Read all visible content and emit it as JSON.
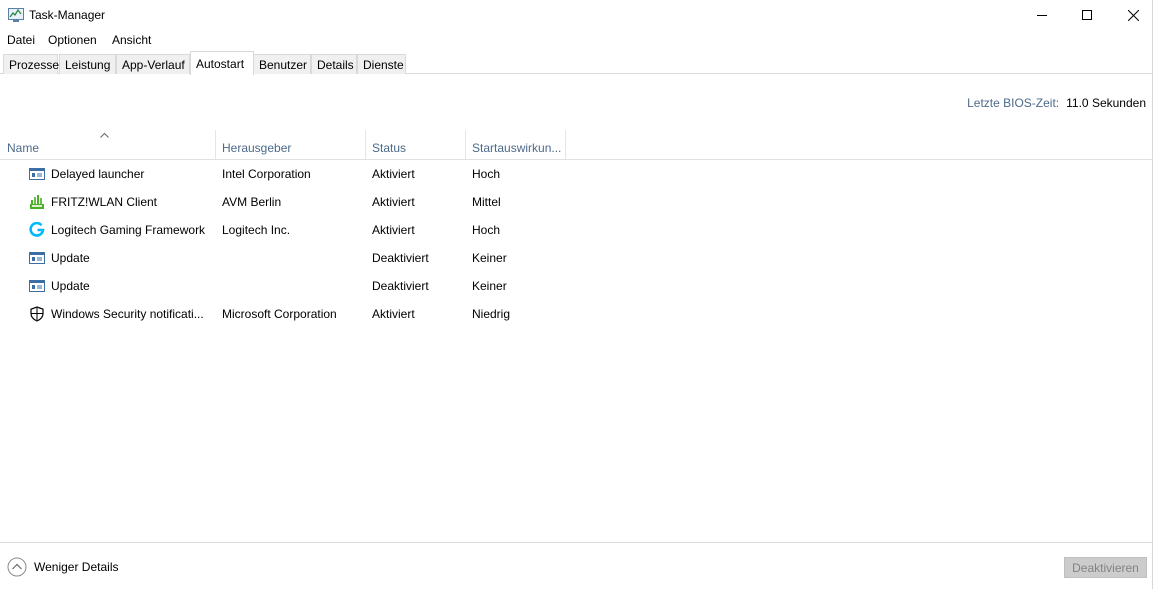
{
  "window": {
    "title": "Task-Manager"
  },
  "menu": [
    "Datei",
    "Optionen",
    "Ansicht"
  ],
  "tabs": [
    {
      "label": "Prozesse",
      "active": false
    },
    {
      "label": "Leistung",
      "active": false
    },
    {
      "label": "App-Verlauf",
      "active": false
    },
    {
      "label": "Autostart",
      "active": true
    },
    {
      "label": "Benutzer",
      "active": false
    },
    {
      "label": "Details",
      "active": false
    },
    {
      "label": "Dienste",
      "active": false
    }
  ],
  "bios": {
    "label": "Letzte BIOS-Zeit:",
    "value": "11.0 Sekunden"
  },
  "table": {
    "columns": [
      "Name",
      "Herausgeber",
      "Status",
      "Startauswirkun..."
    ],
    "rows": [
      {
        "icon": "window-app-icon",
        "name": "Delayed launcher",
        "publisher": "Intel Corporation",
        "status": "Aktiviert",
        "impact": "Hoch"
      },
      {
        "icon": "fritz-wlan-icon",
        "name": "FRITZ!WLAN Client",
        "publisher": "AVM Berlin",
        "status": "Aktiviert",
        "impact": "Mittel"
      },
      {
        "icon": "logitech-g-icon",
        "name": "Logitech Gaming Framework",
        "publisher": "Logitech Inc.",
        "status": "Aktiviert",
        "impact": "Hoch"
      },
      {
        "icon": "window-app-icon",
        "name": "Update",
        "publisher": "",
        "status": "Deaktiviert",
        "impact": "Keiner"
      },
      {
        "icon": "window-app-icon",
        "name": "Update",
        "publisher": "",
        "status": "Deaktiviert",
        "impact": "Keiner"
      },
      {
        "icon": "shield-icon",
        "name": "Windows Security notificati...",
        "publisher": "Microsoft Corporation",
        "status": "Aktiviert",
        "impact": "Niedrig"
      }
    ]
  },
  "footer": {
    "less_details": "Weniger Details",
    "deactivate": "Deaktivieren"
  },
  "colors": {
    "header_text": "#4d6a8a",
    "tab_inactive_bg": "#f0f0f0",
    "button_disabled_bg": "#cccccc",
    "logitech_blue": "#00b8fc",
    "fritz_green": "#4caf2a"
  }
}
